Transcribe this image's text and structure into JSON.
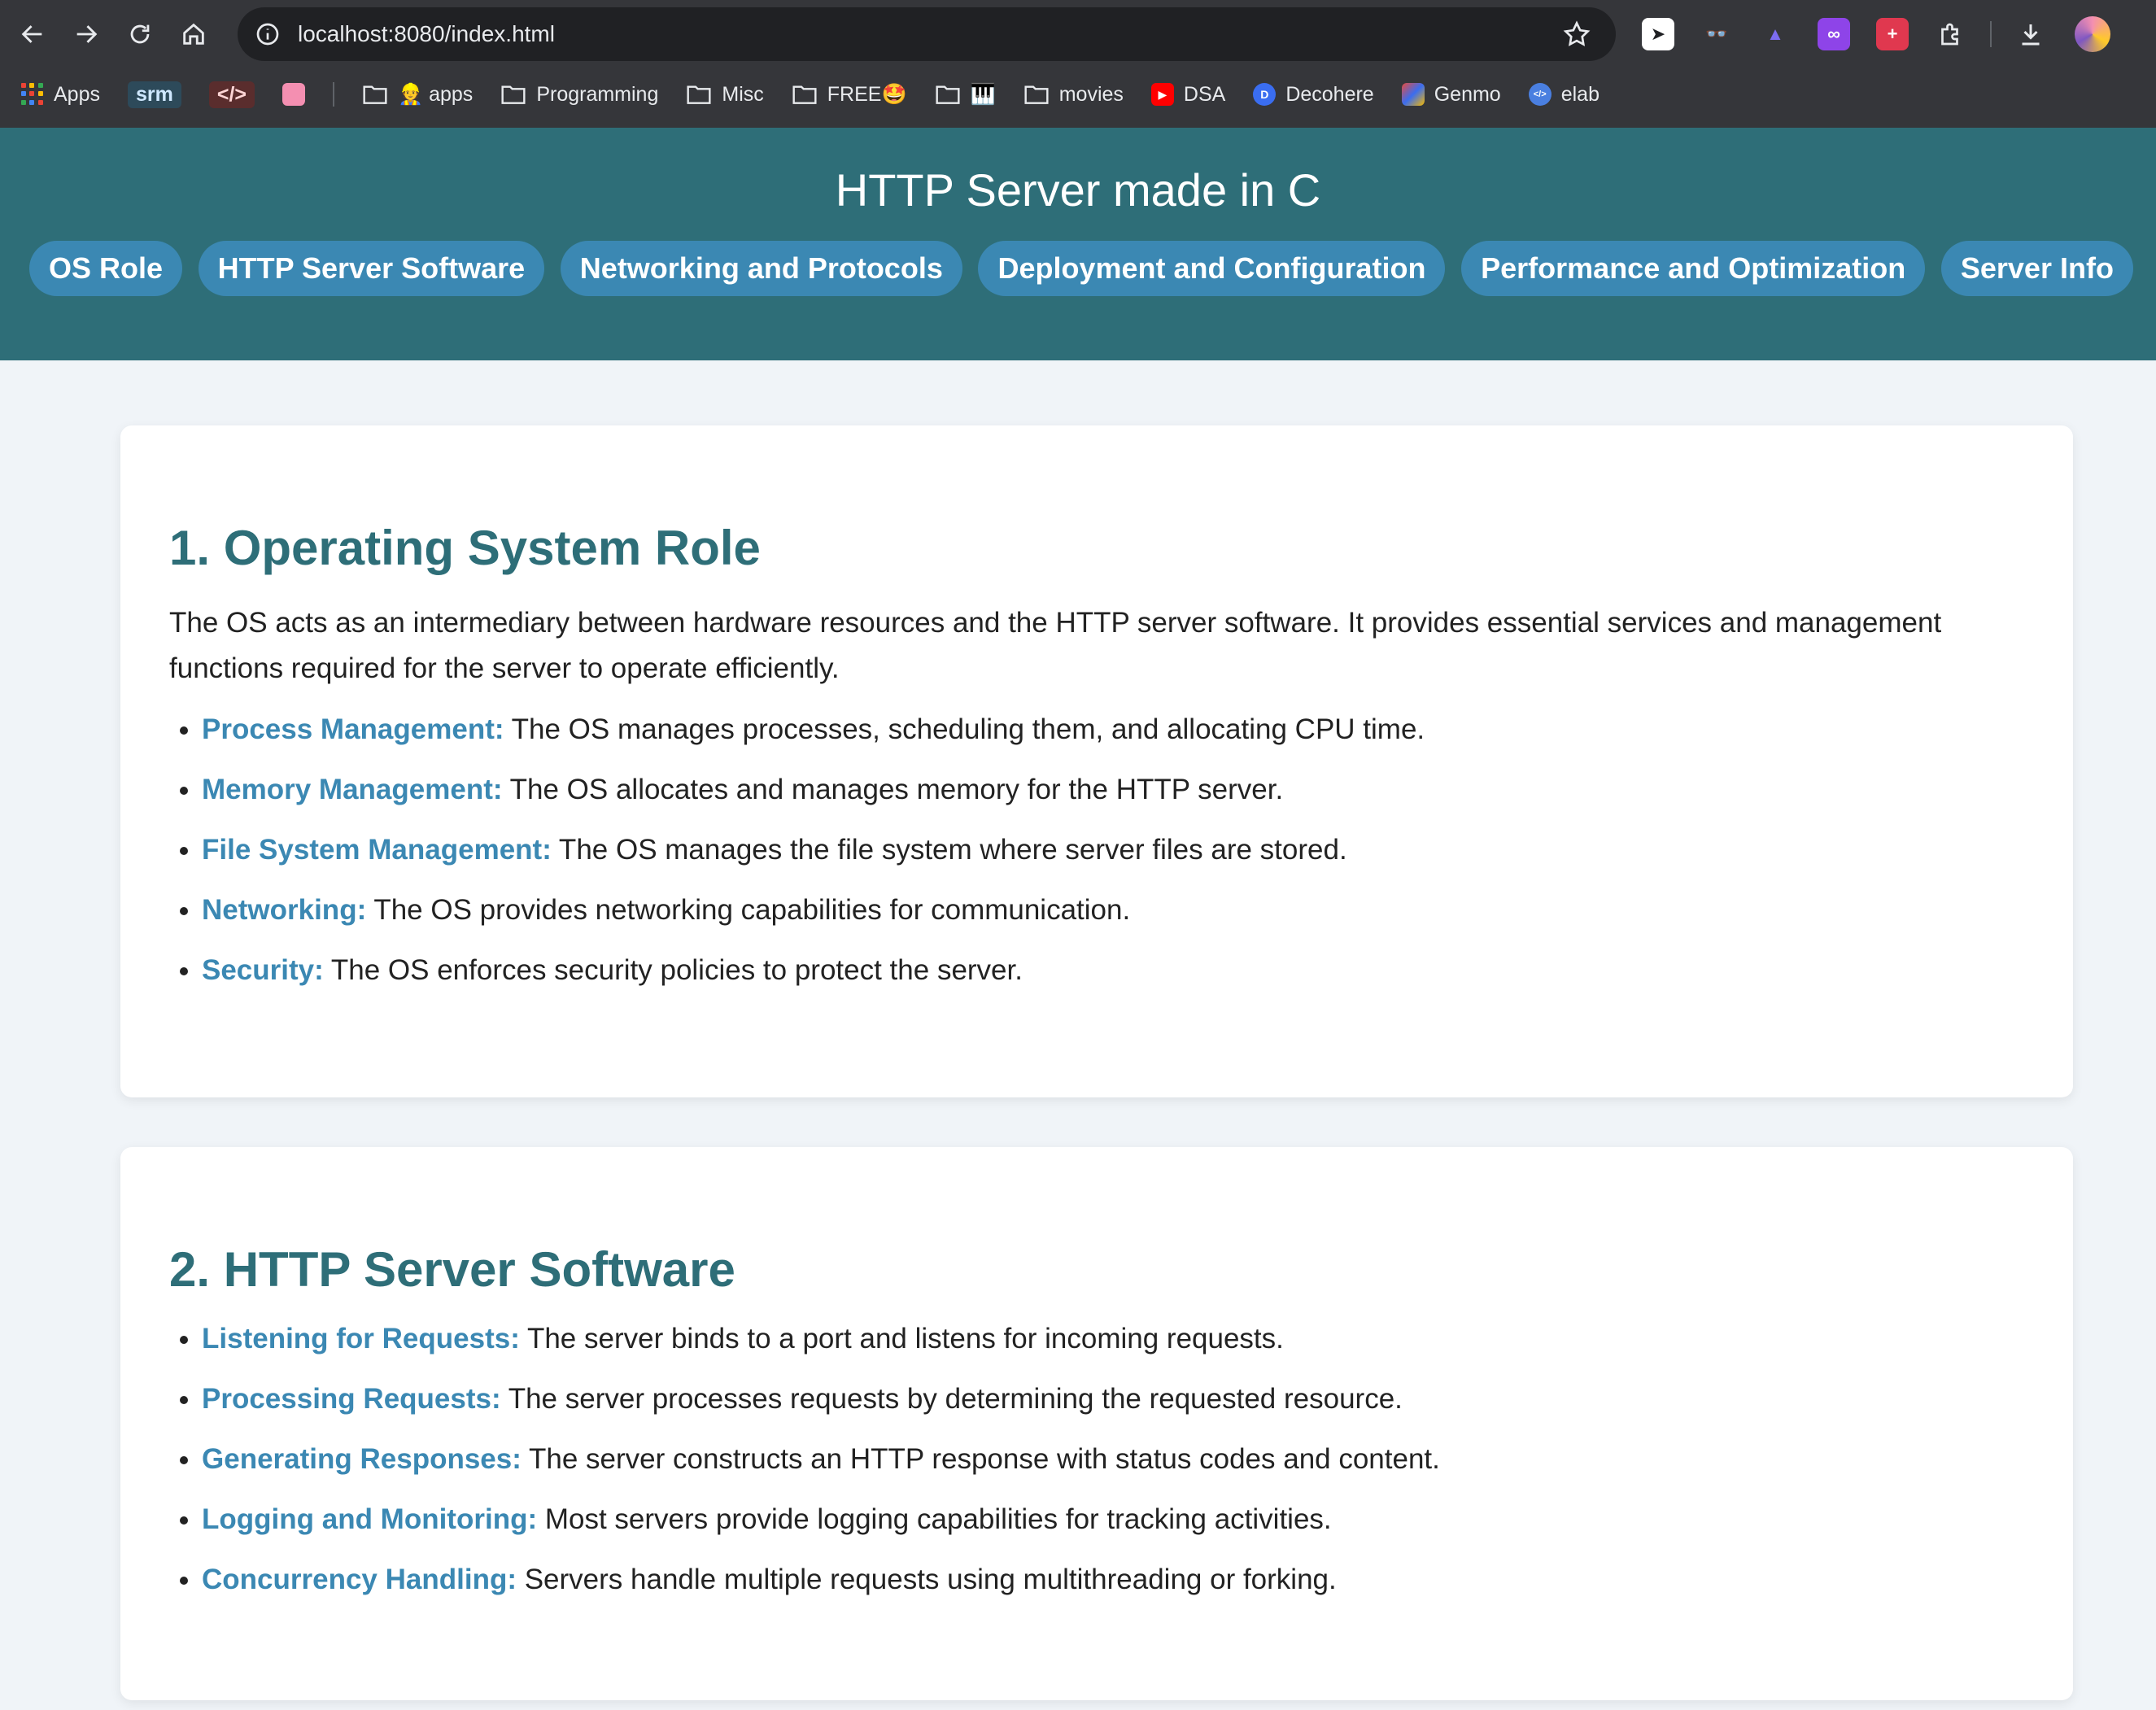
{
  "browser": {
    "url": "localhost:8080/index.html",
    "bookmarks": [
      {
        "label": "Apps",
        "icon": "apps-grid-icon"
      },
      {
        "label": "srm",
        "icon": "chip"
      },
      {
        "label": "</>",
        "icon": "chip"
      },
      {
        "label": "",
        "icon": "pink-square-icon"
      },
      {
        "label": "👷 apps",
        "icon": "folder-icon"
      },
      {
        "label": "Programming",
        "icon": "folder-icon"
      },
      {
        "label": "Misc",
        "icon": "folder-icon"
      },
      {
        "label": "FREE🤩",
        "icon": "folder-icon"
      },
      {
        "label": "🎹",
        "icon": "folder-icon"
      },
      {
        "label": "movies",
        "icon": "folder-icon"
      },
      {
        "label": "DSA",
        "icon": "youtube-icon"
      },
      {
        "label": "Decohere",
        "icon": "decohere-icon"
      },
      {
        "label": "Genmo",
        "icon": "genmo-icon"
      },
      {
        "label": "elab",
        "icon": "elab-icon"
      }
    ]
  },
  "header": {
    "title": "HTTP Server made in C",
    "nav": [
      "OS Role",
      "HTTP Server Software",
      "Networking and Protocols",
      "Deployment and Configuration",
      "Performance and Optimization",
      "Server Info"
    ]
  },
  "sections": [
    {
      "title": "1. Operating System Role",
      "intro": "The OS acts as an intermediary between hardware resources and the HTTP server software. It provides essential services and management functions required for the server to operate efficiently.",
      "items": [
        {
          "term": "Process Management:",
          "text": " The OS manages processes, scheduling them, and allocating CPU time."
        },
        {
          "term": "Memory Management:",
          "text": " The OS allocates and manages memory for the HTTP server."
        },
        {
          "term": "File System Management:",
          "text": " The OS manages the file system where server files are stored."
        },
        {
          "term": "Networking:",
          "text": " The OS provides networking capabilities for communication."
        },
        {
          "term": "Security:",
          "text": " The OS enforces security policies to protect the server."
        }
      ]
    },
    {
      "title": "2. HTTP Server Software",
      "items": [
        {
          "term": "Listening for Requests:",
          "text": " The server binds to a port and listens for incoming requests."
        },
        {
          "term": "Processing Requests:",
          "text": " The server processes requests by determining the requested resource."
        },
        {
          "term": "Generating Responses:",
          "text": " The server constructs an HTTP response with status codes and content."
        },
        {
          "term": "Logging and Monitoring:",
          "text": " Most servers provide logging capabilities for tracking activities."
        },
        {
          "term": "Concurrency Handling:",
          "text": " Servers handle multiple requests using multithreading or forking."
        }
      ]
    }
  ]
}
